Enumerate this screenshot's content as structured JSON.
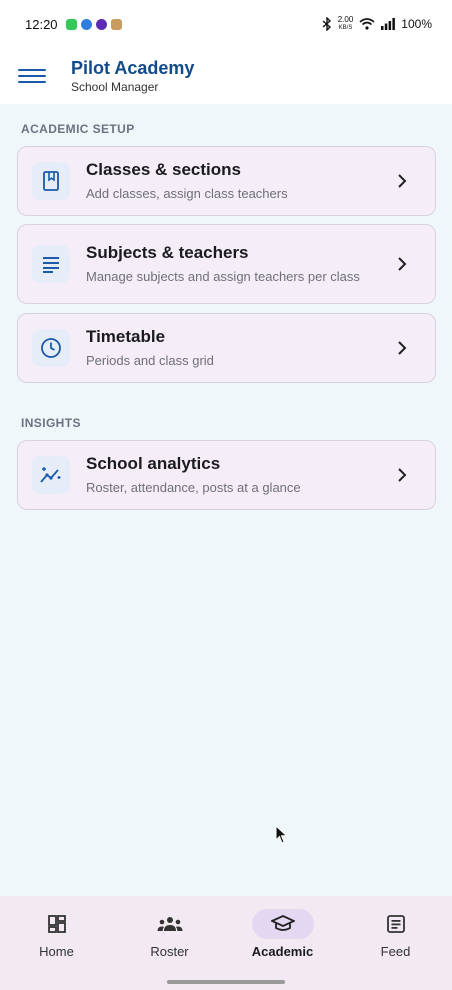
{
  "status_bar": {
    "time": "12:20",
    "network_speed_top": "2.00",
    "network_speed_bottom": "KB/S",
    "battery": "100%"
  },
  "app_bar": {
    "title": "Pilot Academy",
    "subtitle": "School Manager"
  },
  "sections": [
    {
      "label": "ACADEMIC SETUP",
      "items": [
        {
          "title": "Classes & sections",
          "description": "Add classes, assign class teachers",
          "icon": "book-icon"
        },
        {
          "title": "Subjects & teachers",
          "description": "Manage subjects and assign teachers per class",
          "icon": "subject-lines-icon"
        },
        {
          "title": "Timetable",
          "description": "Periods and class grid",
          "icon": "clock-icon"
        }
      ]
    },
    {
      "label": "INSIGHTS",
      "items": [
        {
          "title": "School analytics",
          "description": "Roster, attendance, posts at a glance",
          "icon": "analytics-icon"
        }
      ]
    }
  ],
  "bottom_nav": {
    "active": "Academic",
    "items": [
      {
        "label": "Home",
        "icon": "dashboard-icon"
      },
      {
        "label": "Roster",
        "icon": "group-icon"
      },
      {
        "label": "Academic",
        "icon": "school-cap-icon"
      },
      {
        "label": "Feed",
        "icon": "article-icon"
      }
    ]
  },
  "colors": {
    "accent": "#1a5aa8",
    "title": "#124b8a",
    "background": "#eff7fb",
    "card": "#f5eef8",
    "nav_bg": "#f2e9f3",
    "nav_active": "#e3d7f2"
  }
}
